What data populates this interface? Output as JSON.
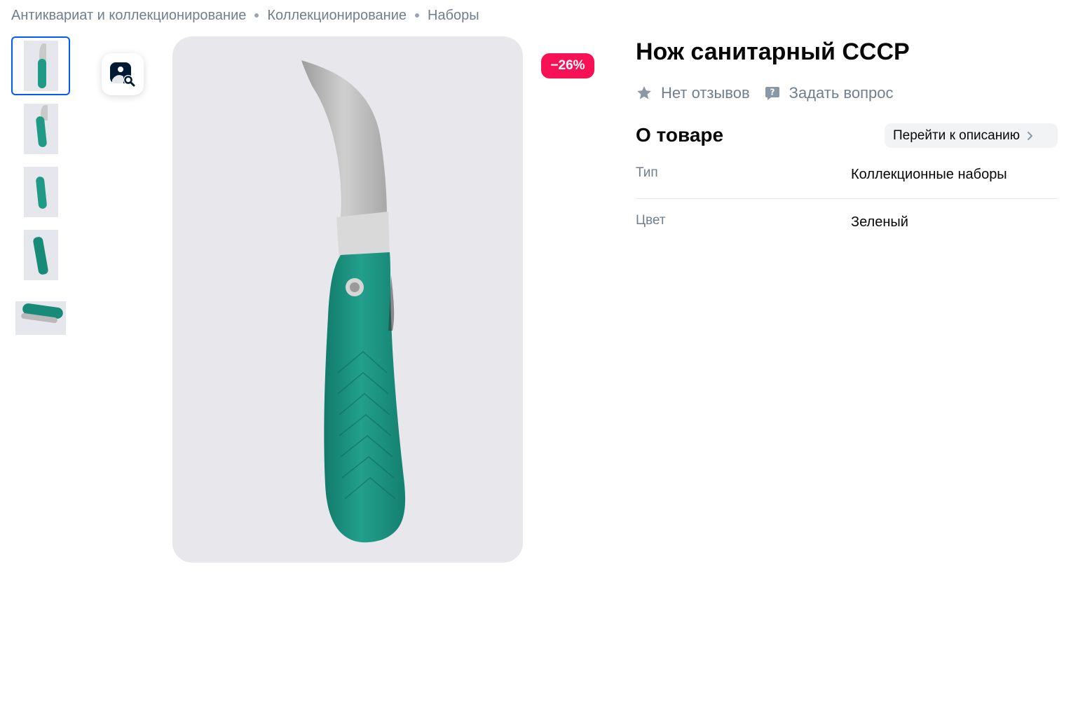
{
  "breadcrumbs": [
    {
      "label": "Антиквариат и коллекционирование"
    },
    {
      "label": "Коллекционирование"
    },
    {
      "label": "Наборы"
    }
  ],
  "gallery": {
    "thumbnail_count": 5,
    "active_index": 0,
    "search_icon": "image-search-icon"
  },
  "product": {
    "discount": "−26%",
    "title": "Нож санитарный СССР",
    "reviews_label": "Нет отзывов",
    "ask_label": "Задать вопрос"
  },
  "about": {
    "title": "О товаре",
    "to_description_label": "Перейти к описанию",
    "specs": [
      {
        "key": "Тип",
        "value": "Коллекционные наборы"
      },
      {
        "key": "Цвет",
        "value": "Зеленый"
      }
    ]
  },
  "colors": {
    "accent": "#005bff",
    "discount": "#f91155",
    "muted_text": "#707f8d",
    "handle_green": "#1e9a86"
  }
}
